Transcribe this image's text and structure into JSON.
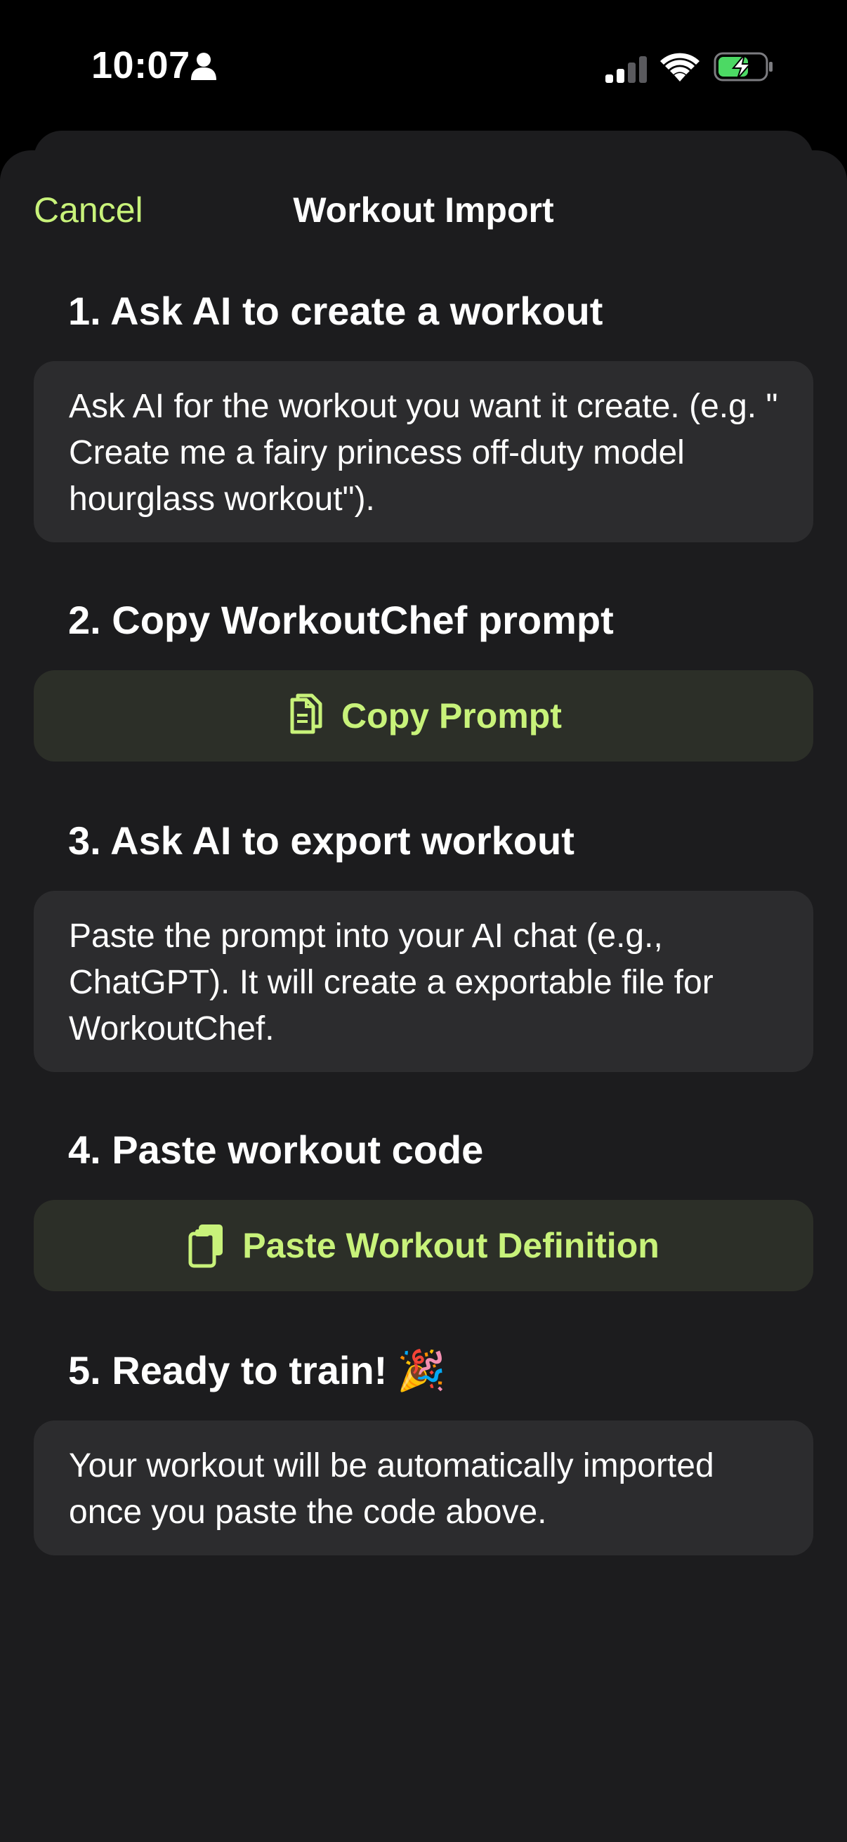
{
  "status_bar": {
    "time": "10:07"
  },
  "nav": {
    "cancel_label": "Cancel",
    "title": "Workout Import"
  },
  "steps": [
    {
      "heading": "1. Ask AI to create a workout",
      "body": "Ask AI for the workout you want it create. (e.g. \" Create me a fairy princess off-duty model hourglass workout\")."
    },
    {
      "heading": "2. Copy WorkoutChef prompt",
      "button_label": "Copy Prompt",
      "button_icon": "copy-icon"
    },
    {
      "heading": "3. Ask AI to export workout",
      "body": "Paste the prompt into your AI chat (e.g., ChatGPT). It will create a exportable file for WorkoutChef."
    },
    {
      "heading": "4. Paste workout code",
      "button_label": "Paste Workout Definition",
      "button_icon": "paste-icon"
    },
    {
      "heading": "5. Ready to train!",
      "heading_emoji": "🎉",
      "body": "Your workout will be automatically imported once you paste the code above."
    }
  ],
  "colors": {
    "accent": "#c8f27a",
    "sheet_bg": "#1c1c1e",
    "card_bg": "#2c2c2e",
    "button_bg": "#2c2f28"
  }
}
